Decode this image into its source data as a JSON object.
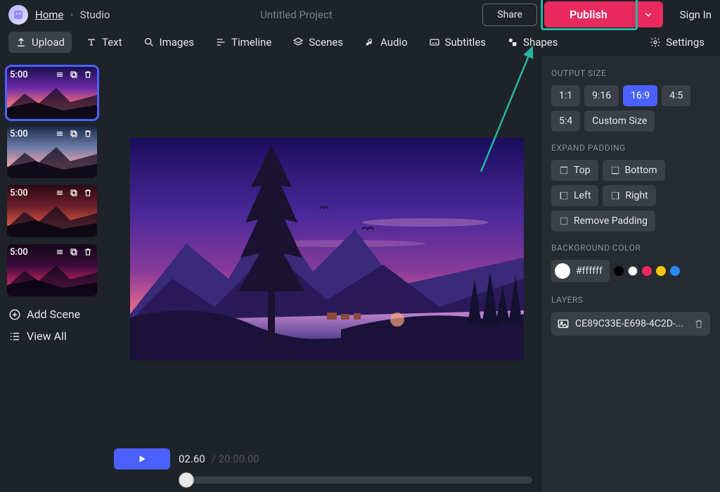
{
  "header": {
    "home": "Home",
    "studio": "Studio",
    "project_title": "Untitled Project",
    "share": "Share",
    "publish": "Publish",
    "signin": "Sign In"
  },
  "toolbar": {
    "upload": "Upload",
    "text": "Text",
    "images": "Images",
    "timeline": "Timeline",
    "scenes": "Scenes",
    "audio": "Audio",
    "subtitles": "Subtitles",
    "shapes": "Shapes",
    "settings": "Settings"
  },
  "scenes": {
    "items": [
      {
        "time": "5:00",
        "selected": true,
        "gradient": [
          "#1b0f4f",
          "#6a2aa8",
          "#e86a7a",
          "#f5b183"
        ]
      },
      {
        "time": "5:00",
        "selected": false,
        "gradient": [
          "#1a2846",
          "#6a7ba8",
          "#d89aa8",
          "#e6c2a8"
        ]
      },
      {
        "time": "5:00",
        "selected": false,
        "gradient": [
          "#2d0814",
          "#6a1e2a",
          "#c04a3a",
          "#e89a3a"
        ]
      },
      {
        "time": "5:00",
        "selected": false,
        "gradient": [
          "#120818",
          "#3a0a3a",
          "#a8205a",
          "#f54a7a"
        ]
      }
    ],
    "add": "Add Scene",
    "view_all": "View All"
  },
  "playback": {
    "current": "02.60",
    "total": "20:00.00"
  },
  "panel": {
    "output_size_label": "OUTPUT SIZE",
    "ratios": [
      "1:1",
      "9:16",
      "16:9",
      "4:5",
      "5:4"
    ],
    "ratio_selected": "16:9",
    "custom_size": "Custom Size",
    "expand_label": "EXPAND PADDING",
    "pad_top": "Top",
    "pad_bottom": "Bottom",
    "pad_left": "Left",
    "pad_right": "Right",
    "pad_remove": "Remove Padding",
    "bg_label": "BACKGROUND COLOR",
    "bg_value": "#ffffff",
    "bg_presets": [
      "#000000",
      "#ffffff",
      "#e82a5e",
      "#f5c60a",
      "#2a8af5"
    ],
    "layers_label": "LAYERS",
    "layer_name": "CE89C33E-E698-4C2D-..."
  }
}
